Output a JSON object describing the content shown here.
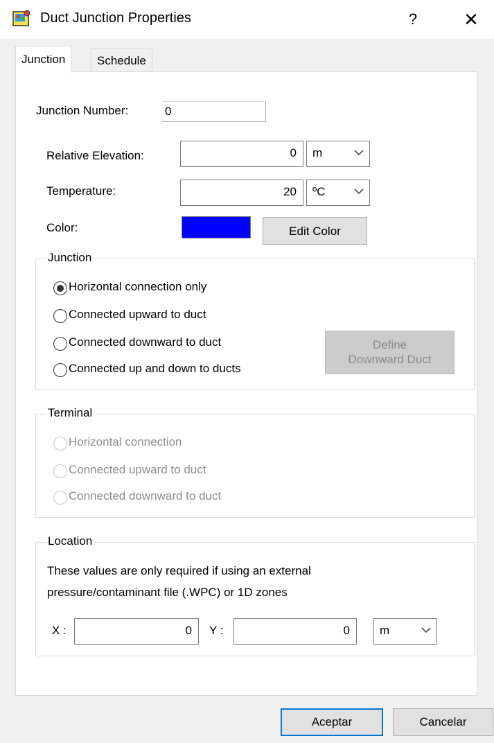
{
  "window": {
    "title": "Duct Junction Properties",
    "help": "?",
    "close": "✕"
  },
  "tabs": [
    {
      "label": "Junction"
    },
    {
      "label": "Schedule"
    }
  ],
  "junction_number": {
    "label": "Junction Number:",
    "value": "0"
  },
  "relative_elevation": {
    "label": "Relative Elevation:",
    "value": "0",
    "unit": "m"
  },
  "temperature": {
    "label": "Temperature:",
    "value": "20",
    "unit": "ºC"
  },
  "color": {
    "label": "Color:",
    "swatch": "#0000ff",
    "button": "Edit Color"
  },
  "junction_group": {
    "title": "Junction",
    "options": [
      "Horizontal connection only",
      "Connected upward to duct",
      "Connected downward to duct",
      "Connected up and down to ducts"
    ],
    "selected": 0,
    "define_button_line1": "Define",
    "define_button_line2": "Downward Duct"
  },
  "terminal_group": {
    "title": "Terminal",
    "options": [
      "Horizontal connection",
      "Connected upward to duct",
      "Connected downward to duct"
    ]
  },
  "location_group": {
    "title": "Location",
    "note_line1": "These values are only required if using an external",
    "note_line2": "pressure/contaminant file (.WPC) or 1D zones",
    "x_label": "X :",
    "x_value": "0",
    "y_label": "Y :",
    "y_value": "0",
    "unit": "m"
  },
  "buttons": {
    "ok": "Aceptar",
    "cancel": "Cancelar"
  }
}
